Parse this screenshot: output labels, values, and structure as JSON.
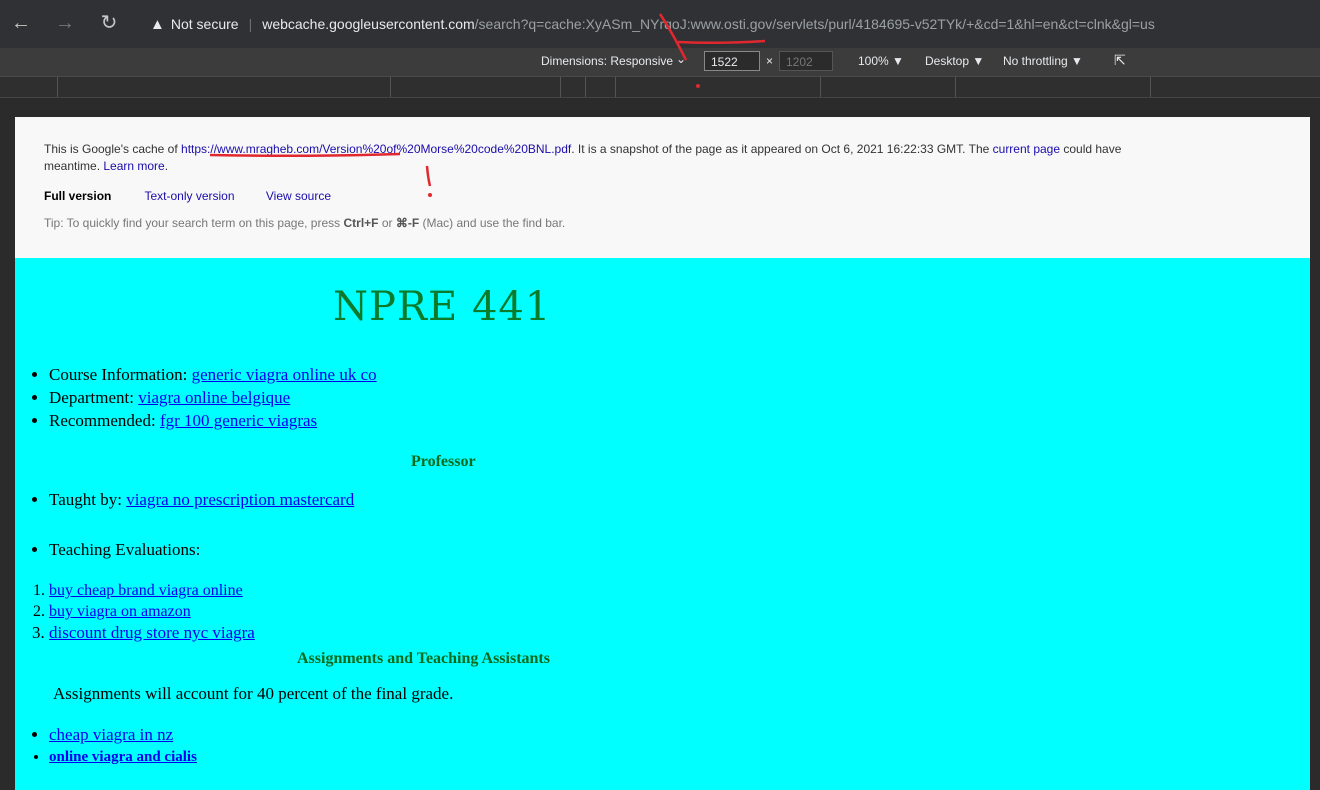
{
  "browser": {
    "security_label": "Not secure",
    "url_host": "webcache.googleusercontent.com",
    "url_rest": "/search?q=cache:XyASm_NYrqoJ:www.osti.gov/servlets/purl/4184695-v52TYk/+&cd=1&hl=en&ct=clnk&gl=us"
  },
  "devtools": {
    "dimensions_label": "Dimensions: Responsive",
    "width_value": "1522",
    "times": "×",
    "height_value": "1202",
    "zoom": "100% ▼",
    "device": "Desktop ▼",
    "throttle": "No throttling ▼"
  },
  "cache": {
    "intro": "This is Google's cache of ",
    "cached_url": "https://www.mragheb.com/Version%20of%20Morse%20code%20BNL.pdf",
    "snapshot": ". It is a snapshot of the page as it appeared on Oct 6, 2021 16:22:33 GMT. The ",
    "current_page": "current page",
    "could_have": " could have",
    "meantime": "meantime. ",
    "learn_more": "Learn more",
    "period": ".",
    "full_version": "Full version",
    "text_only": "Text-only version",
    "view_source": "View source",
    "tip_a": "Tip: To quickly find your search term on this page, press ",
    "tip_ctrl": "Ctrl+F",
    "tip_or": " or ",
    "tip_cmd": "⌘-F",
    "tip_b": " (Mac) and use the find bar."
  },
  "page": {
    "title": "NPRE 441",
    "info": [
      {
        "label": "Course Information: ",
        "link": "generic viagra online uk co"
      },
      {
        "label": "Department: ",
        "link": "viagra online belgique"
      },
      {
        "label": "Recommended: ",
        "link": "fgr 100 generic viagras"
      }
    ],
    "professor_head": "Professor",
    "taught_label": "Taught by: ",
    "taught_link": "viagra no prescription mastercard",
    "evaluations_label": "Teaching Evaluations:",
    "eval_links": [
      "buy cheap brand viagra online",
      "buy viagra on amazon",
      "discount drug store nyc viagra"
    ],
    "assign_head": "Assignments and Teaching Assistants",
    "assign_text": "Assignments will account for 40 percent of the final grade.",
    "assign_links": [
      "cheap viagra in nz",
      "online viagra and cialis"
    ]
  }
}
